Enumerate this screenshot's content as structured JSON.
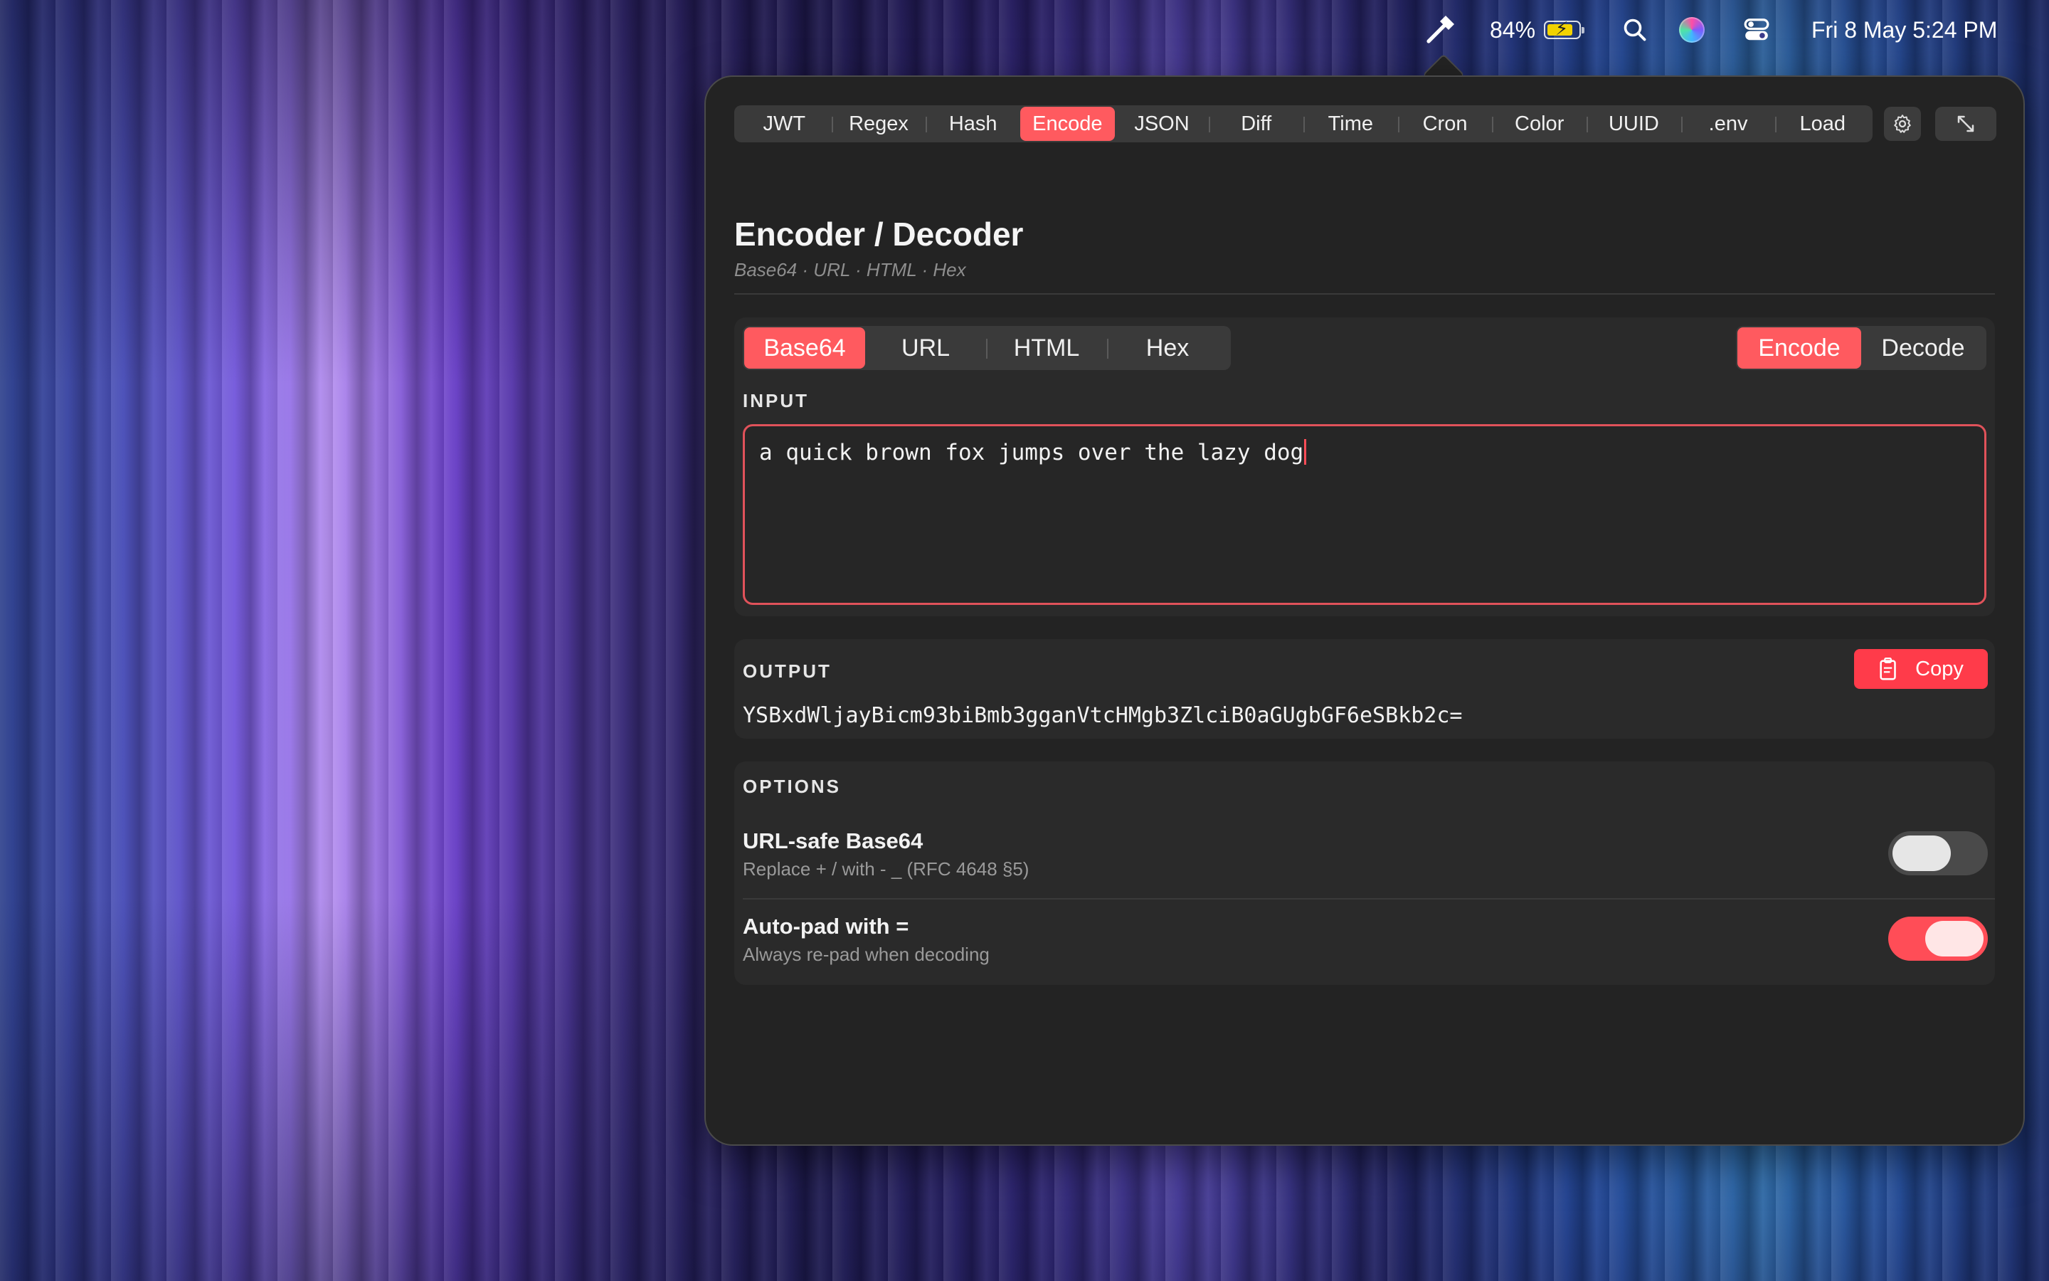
{
  "menubar": {
    "battery_percent": "84%",
    "battery_level": 0.84,
    "datetime": "Fri 8 May  5:24 PM",
    "icons": [
      "hammer-icon",
      "battery-icon",
      "search-icon",
      "siri-icon",
      "control-center-icon"
    ]
  },
  "tabs": [
    "JWT",
    "Regex",
    "Hash",
    "Encode",
    "JSON",
    "Diff",
    "Time",
    "Cron",
    "Color",
    "UUID",
    ".env",
    "Load"
  ],
  "active_tab": "Encode",
  "header": {
    "title": "Encoder / Decoder",
    "subtitle": "Base64 · URL · HTML · Hex"
  },
  "encoding": {
    "formats": [
      "Base64",
      "URL",
      "HTML",
      "Hex"
    ],
    "active_format": "Base64",
    "modes": [
      "Encode",
      "Decode"
    ],
    "active_mode": "Encode"
  },
  "input": {
    "label": "INPUT",
    "value": "a quick brown fox jumps over the lazy dog"
  },
  "output": {
    "label": "OUTPUT",
    "value": "YSBxdWljayBicm93biBmb3gganVtcHMgb3ZlciB0aGUgbGF6eSBkb2c=",
    "copy_label": "Copy"
  },
  "options": {
    "label": "OPTIONS",
    "items": [
      {
        "title": "URL-safe Base64",
        "desc": "Replace + / with - _  (RFC 4648 §5)",
        "enabled": false
      },
      {
        "title": "Auto-pad with =",
        "desc": "Always re-pad when decoding",
        "enabled": true
      }
    ]
  },
  "colors": {
    "accent": "#ff5a5f",
    "window_bg": "#232323",
    "card_bg": "#2a2a2a"
  }
}
